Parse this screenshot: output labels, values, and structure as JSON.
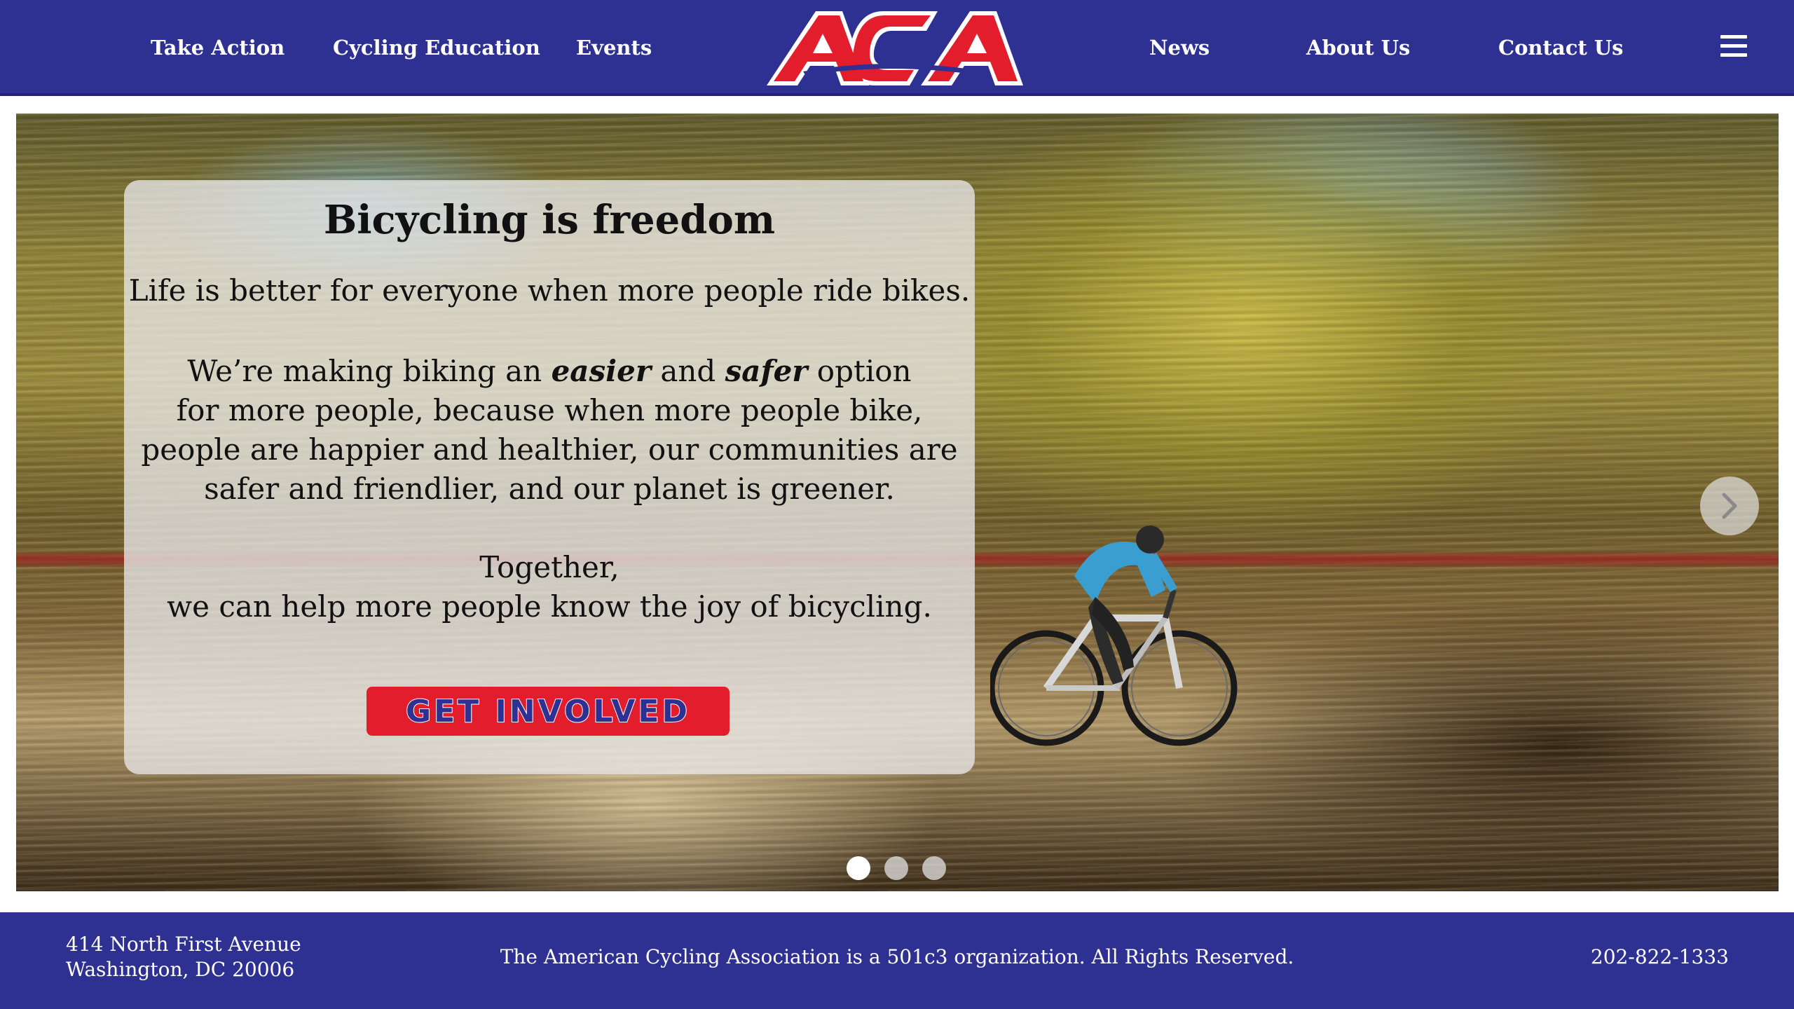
{
  "header": {
    "nav_left": [
      "Take Action",
      "Cycling Education",
      "Events"
    ],
    "logo_text": "ACA",
    "nav_right": [
      "News",
      "About Us",
      "Contact Us"
    ],
    "menu_icon": "hamburger-icon"
  },
  "colors": {
    "brand_blue": "#2e3192",
    "brand_red": "#e31d2b",
    "white": "#ffffff"
  },
  "hero": {
    "title": "Bicycling is freedom",
    "lead": "Life is better for everyone when more people ride bikes.",
    "body": {
      "line1_a": "We’re making biking an ",
      "line1_em1": "easier",
      "line1_b": " and ",
      "line1_em2": "safer",
      "line1_c": " option",
      "line2": "for more people, because when more people bike,",
      "line3": "people are happier and healthier, our communities are",
      "line4": "safer and friendlier, and our planet is greener."
    },
    "together_line1": "Together,",
    "together_line2": "we can help more people know the joy of bicycling.",
    "cta_label": "GET INVOLVED",
    "next_icon": "chevron-right-icon",
    "slides_total": 3,
    "active_slide": 1
  },
  "footer": {
    "address_line1": "414 North First Avenue",
    "address_line2": "Washington, DC 20006",
    "notice": "The American Cycling Association is a 501c3 organization. All Rights Reserved.",
    "phone": "202-822-1333"
  }
}
